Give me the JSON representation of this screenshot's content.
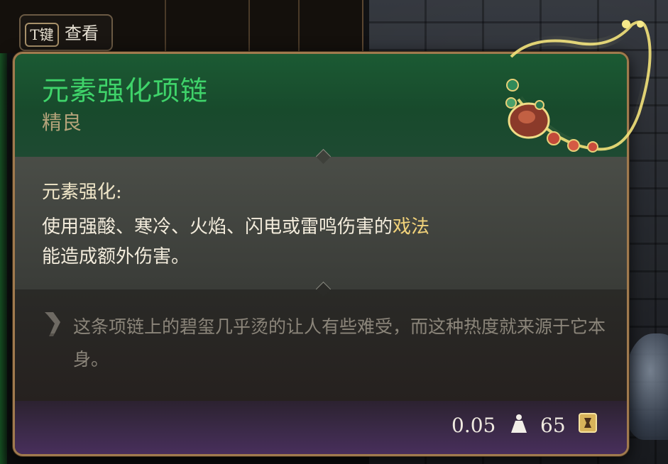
{
  "key_hint": {
    "key": "T键",
    "label": "查看"
  },
  "item": {
    "name": "元素强化项链",
    "rarity": "精良",
    "name_color": "#3fd36a",
    "rarity_color": "#b4a37a"
  },
  "effect": {
    "title": "元素强化:",
    "desc_part1": "使用强酸、寒冷、火焰、闪电或雷鸣伤害的",
    "desc_highlight": "戏法",
    "desc_part2": "能造成额外伤害。"
  },
  "lore": {
    "icon": "quill-icon",
    "text": "这条项链上的碧玺几乎烫的让人有些难受，而这种热度就来源于它本身。"
  },
  "footer": {
    "weight": "0.05",
    "weight_icon": "weight-icon",
    "value": "65",
    "value_icon": "gold-coin-icon"
  },
  "colors": {
    "header_bg": "#1b5a33",
    "border": "#a07a4e",
    "footer_bg": "#4a2f5e"
  }
}
